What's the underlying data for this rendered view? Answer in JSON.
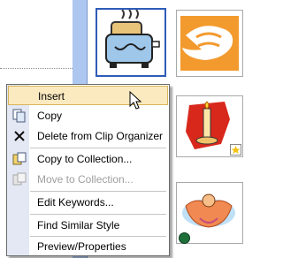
{
  "context_menu": {
    "items": [
      {
        "label": "Insert",
        "state": "highlighted",
        "icon": null
      },
      {
        "label": "Copy",
        "state": "normal",
        "icon": "copy-icon"
      },
      {
        "label": "Delete from Clip Organizer",
        "state": "normal",
        "icon": "delete-x-icon"
      },
      {
        "label": "Copy to Collection...",
        "state": "normal",
        "icon": "copy-to-collection-icon"
      },
      {
        "label": "Move to Collection...",
        "state": "disabled",
        "icon": "move-to-collection-icon"
      },
      {
        "label": "Edit Keywords...",
        "state": "normal",
        "icon": null
      },
      {
        "label": "Find Similar Style",
        "state": "normal",
        "icon": null
      },
      {
        "label": "Preview/Properties",
        "state": "normal",
        "icon": null
      }
    ]
  },
  "gallery": {
    "clips": [
      {
        "name": "toaster-clipart",
        "selected": true
      },
      {
        "name": "cornucopia-clipart",
        "selected": false
      },
      {
        "name": "candle-clipart",
        "badge": "star-badge-icon"
      },
      {
        "name": "angel-clipart",
        "badge": "globe-badge-icon"
      }
    ]
  },
  "colors": {
    "menu_highlight": "#fbeac0",
    "menu_gutter": "#e3e8f4",
    "side_bar": "#adc7f0",
    "selection_border": "#2e5cb8"
  }
}
